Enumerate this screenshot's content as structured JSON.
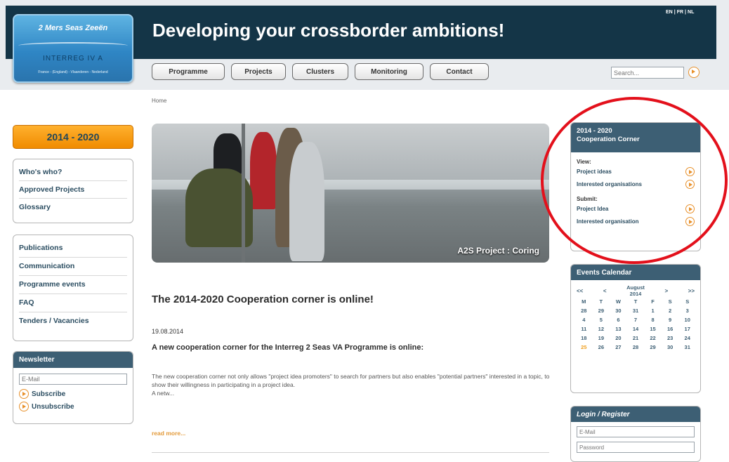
{
  "header": {
    "logo": {
      "line1": "2 Mers Seas Zeeën",
      "line2": "INTERREG IV A",
      "line3": "France - (England) - Vlaanderen - Nederland"
    },
    "tagline": "Developing your crossborder ambitions!",
    "languages": [
      "EN",
      "FR",
      "NL"
    ],
    "nav": [
      "Programme",
      "Projects",
      "Clusters",
      "Monitoring",
      "Contact"
    ],
    "search_placeholder": "Search..."
  },
  "breadcrumb": "Home",
  "left": {
    "period_button": "2014 - 2020",
    "box1": [
      "Who's who?",
      "Approved Projects",
      "Glossary"
    ],
    "box2": [
      "Publications",
      "Communication",
      "Programme events",
      "FAQ",
      "Tenders / Vacancies"
    ],
    "newsletter": {
      "title": "Newsletter",
      "email_placeholder": "E-Mail",
      "subscribe": "Subscribe",
      "unsubscribe": "Unsubscribe"
    }
  },
  "hero": {
    "caption": "A2S Project : Coring"
  },
  "article": {
    "title": "The 2014-2020 Cooperation corner is online!",
    "date": "19.08.2014",
    "subtitle": "A new cooperation corner for the Interreg 2 Seas VA Programme is online:",
    "body": "The new cooperation corner not only allows \"project idea promoters\" to search for partners but also enables \"potential partners\" interested in a topic, to show their willingness in participating in a project idea.",
    "body2": "A netw...",
    "read_more": "read more..."
  },
  "coop": {
    "title_line1": "2014 - 2020",
    "title_line2": "Cooperation Corner",
    "view_label": "View:",
    "view_items": [
      "Project ideas",
      "Interested organisations"
    ],
    "submit_label": "Submit:",
    "submit_items": [
      "Project Idea",
      "Interested organisation"
    ]
  },
  "calendar": {
    "title": "Events Calendar",
    "nav": {
      "prev_year": "<<",
      "prev": "<",
      "next": ">",
      "next_year": ">>"
    },
    "month": "August",
    "year": "2014",
    "weekdays": [
      "M",
      "T",
      "W",
      "T",
      "F",
      "S",
      "S"
    ],
    "weeks": [
      [
        "28",
        "29",
        "30",
        "31",
        "1",
        "2",
        "3"
      ],
      [
        "4",
        "5",
        "6",
        "7",
        "8",
        "9",
        "10"
      ],
      [
        "11",
        "12",
        "13",
        "14",
        "15",
        "16",
        "17"
      ],
      [
        "18",
        "19",
        "20",
        "21",
        "22",
        "23",
        "24"
      ],
      [
        "25",
        "26",
        "27",
        "28",
        "29",
        "30",
        "31"
      ]
    ],
    "highlight_day": "25"
  },
  "login": {
    "title": "Login / Register",
    "email_placeholder": "E-Mail",
    "password_placeholder": "Password"
  },
  "colors": {
    "header_bg": "#143547",
    "accent_orange": "#f39a12",
    "panel_head": "#3d5f74",
    "annotation_red": "#e3101b"
  }
}
